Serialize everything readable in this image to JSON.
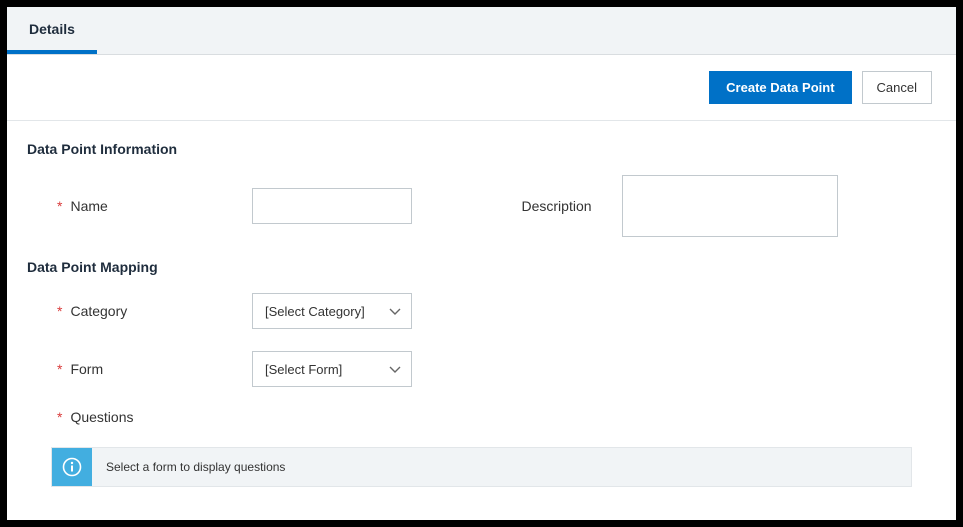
{
  "tabs": {
    "details": "Details"
  },
  "actions": {
    "create": "Create Data Point",
    "cancel": "Cancel"
  },
  "sections": {
    "info_header": "Data Point Information",
    "mapping_header": "Data Point Mapping"
  },
  "fields": {
    "name_label": "Name",
    "description_label": "Description",
    "category_label": "Category",
    "form_label": "Form",
    "questions_label": "Questions",
    "name_value": "",
    "description_value": ""
  },
  "dropdowns": {
    "category_placeholder": "[Select Category]",
    "form_placeholder": "[Select Form]"
  },
  "banner": {
    "message": "Select a form to display questions"
  }
}
